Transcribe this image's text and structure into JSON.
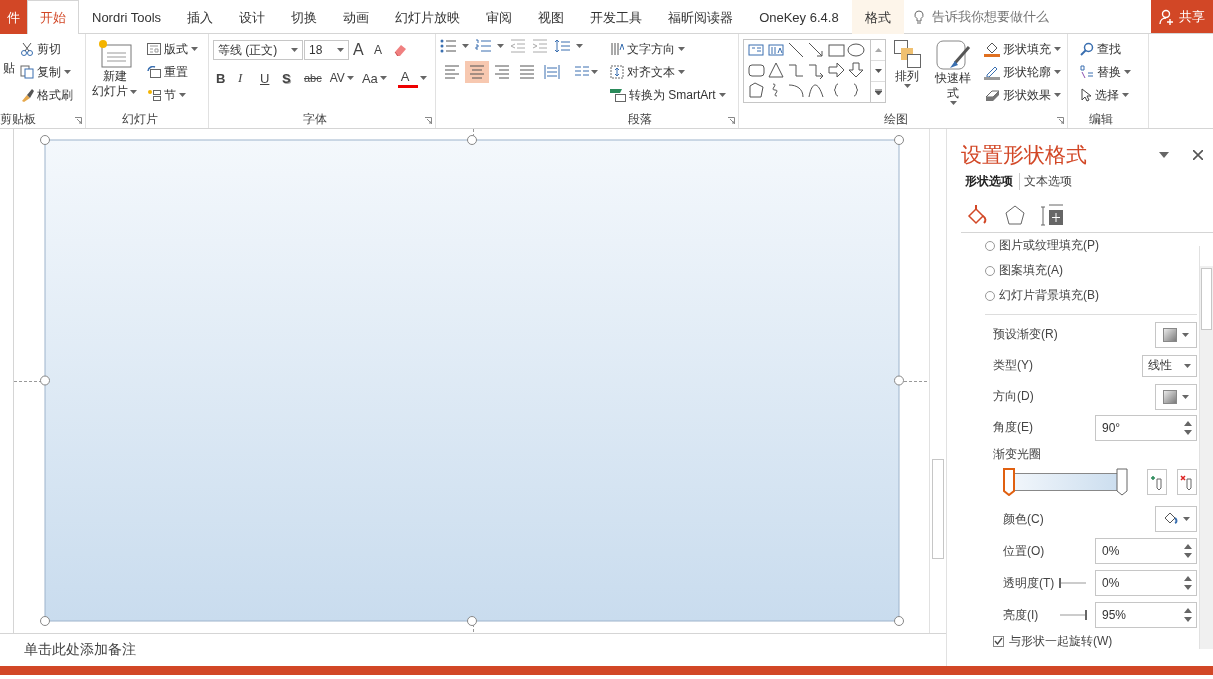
{
  "tabs": [
    {
      "label": "件",
      "kind": "file",
      "selected": false
    },
    {
      "label": "开始",
      "kind": "tab",
      "selected": true
    },
    {
      "label": "Nordri Tools",
      "kind": "tab",
      "selected": false
    },
    {
      "label": "插入",
      "kind": "tab",
      "selected": false
    },
    {
      "label": "设计",
      "kind": "tab",
      "selected": false
    },
    {
      "label": "切换",
      "kind": "tab",
      "selected": false
    },
    {
      "label": "动画",
      "kind": "tab",
      "selected": false
    },
    {
      "label": "幻灯片放映",
      "kind": "tab",
      "selected": false
    },
    {
      "label": "审阅",
      "kind": "tab",
      "selected": false
    },
    {
      "label": "视图",
      "kind": "tab",
      "selected": false
    },
    {
      "label": "开发工具",
      "kind": "tab",
      "selected": false
    },
    {
      "label": "福昕阅读器",
      "kind": "tab",
      "selected": false
    },
    {
      "label": "OneKey 6.4.8",
      "kind": "tab",
      "selected": false
    },
    {
      "label": "格式",
      "kind": "context",
      "selected": false
    }
  ],
  "tell_me": {
    "placeholder": "告诉我你想要做什么"
  },
  "share_button": "共享",
  "ribbon": {
    "clipboard": {
      "label": "剪贴板",
      "paste": "贴",
      "cut": "剪切",
      "copy": "复制",
      "format_painter": "格式刷"
    },
    "slides": {
      "label": "幻灯片",
      "new_slide": [
        "新建",
        "幻灯片"
      ],
      "layout": "版式",
      "reset": "重置",
      "section": "节"
    },
    "font": {
      "label": "字体",
      "font_name": "等线 (正文)",
      "font_size": "18",
      "grow": "A",
      "shrink": "A",
      "bold": "B",
      "italic": "I",
      "underline": "U",
      "shadow": "S",
      "strike": "abc",
      "spacing": "AV",
      "case": "Aa",
      "font_color": "A"
    },
    "paragraph": {
      "label": "段落",
      "align": [
        {
          "kind": "left",
          "selected": false
        },
        {
          "kind": "center",
          "selected": true
        },
        {
          "kind": "right",
          "selected": false
        },
        {
          "kind": "justify",
          "selected": false
        },
        {
          "kind": "distributed",
          "selected": false
        }
      ],
      "text_direction": "文字方向",
      "align_text": "对齐文本",
      "smartart": "转换为 SmartArt"
    },
    "drawing": {
      "label": "绘图",
      "arrange": "排列",
      "quick_styles": "快速样式",
      "fill": "形状填充",
      "outline": "形状轮廓",
      "effects": "形状效果"
    },
    "editing": {
      "label": "编辑",
      "find": "查找",
      "replace": "替换",
      "select": "选择"
    }
  },
  "notes": {
    "placeholder": "单击此处添加备注"
  },
  "pane": {
    "title": "设置形状格式",
    "tabs": [
      {
        "label": "形状选项",
        "selected": true
      },
      {
        "label": "文本选项",
        "selected": false
      }
    ],
    "icon_tabs": [
      {
        "selected": true
      },
      {
        "selected": false
      },
      {
        "selected": false
      }
    ],
    "fill_options": [
      {
        "label": "图片或纹理填充(P)",
        "selected": false
      },
      {
        "label": "图案填充(A)",
        "selected": false
      },
      {
        "label": "幻灯片背景填充(B)",
        "selected": false
      }
    ],
    "rows": [
      {
        "kind": "swatch",
        "label": "预设渐变(R)"
      },
      {
        "kind": "select",
        "label": "类型(Y)",
        "value": "线性"
      },
      {
        "kind": "swatch",
        "label": "方向(D)"
      },
      {
        "kind": "spin",
        "label": "角度(E)",
        "value": "90°"
      }
    ],
    "gradient_label": "渐变光圈",
    "stops": [
      {
        "level": 0,
        "selected": true
      },
      {
        "level": 1,
        "selected": false
      }
    ],
    "stop_rows": [
      {
        "kind": "color",
        "label": "颜色(C)"
      },
      {
        "kind": "spin",
        "label": "位置(O)",
        "value": "0%"
      },
      {
        "kind": "transparency-spin",
        "label": "透明度(T)",
        "value": "0%"
      },
      {
        "kind": "brightness-spin",
        "label": "亮度(I)",
        "value": "95%"
      }
    ],
    "rotate_with_shape": {
      "label": "与形状一起旋转(W)",
      "checked": true
    }
  }
}
